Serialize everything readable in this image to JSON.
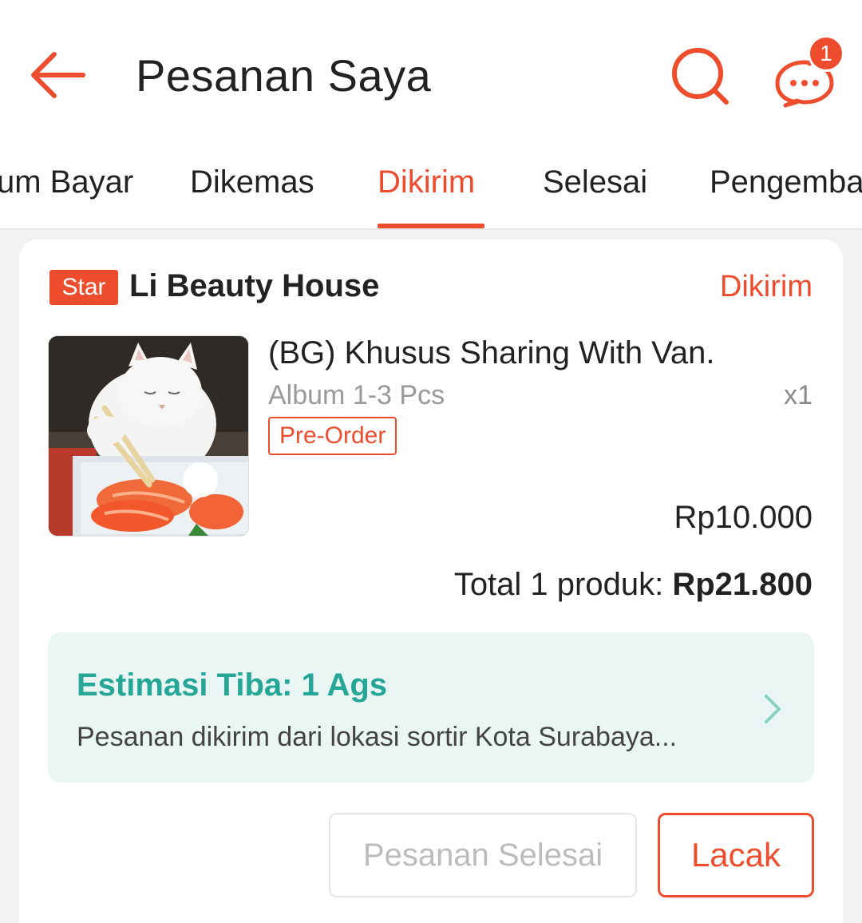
{
  "header": {
    "title": "Pesanan Saya",
    "chat_badge_count": "1"
  },
  "tabs": [
    {
      "label": "Belum Bayar",
      "visible_text": "um Bayar"
    },
    {
      "label": "Dikemas"
    },
    {
      "label": "Dikirim",
      "active": true
    },
    {
      "label": "Selesai"
    },
    {
      "label": "Pengembalian",
      "visible_text": "Pengemba"
    }
  ],
  "order": {
    "badge": "Star",
    "shop_name": "Li Beauty House",
    "status": "Dikirim",
    "product": {
      "name": "(BG) Khusus Sharing With Van.",
      "variant": "Album 1-3 Pcs",
      "quantity": "x1",
      "tag": "Pre-Order",
      "price": "Rp10.000",
      "image_description": "white cat with chopsticks and salmon sashimi"
    },
    "total_label": "Total 1 produk:",
    "total_amount": "Rp21.800",
    "shipping": {
      "eta": "Estimasi Tiba: 1 Ags",
      "message": "Pesanan dikirim dari lokasi sortir Kota Surabaya..."
    },
    "buttons": {
      "complete": "Pesanan Selesai",
      "track": "Lacak"
    }
  },
  "colors": {
    "accent": "#ee4d2d",
    "teal": "#26a696",
    "shipping_bg": "#e9f6f4"
  }
}
